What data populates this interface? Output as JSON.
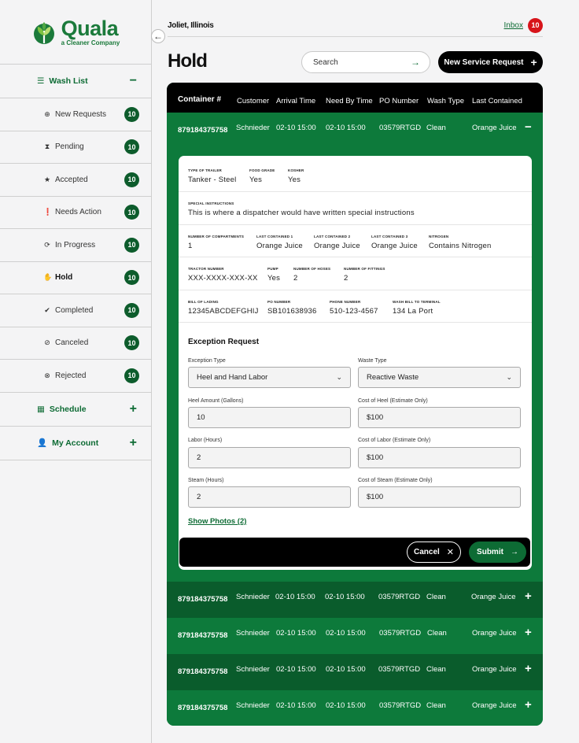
{
  "brand": {
    "name": "Quala",
    "tagline": "a Cleaner Company"
  },
  "colors": {
    "primary": "#0d7a3b",
    "dark_green": "#0d5c2c",
    "alert_red": "#d7141a",
    "black": "#000000"
  },
  "sidebar": {
    "wash_list": {
      "label": "Wash List",
      "toggle": "−",
      "icon": "list-icon"
    },
    "items": [
      {
        "label": "New Requests",
        "count": "10",
        "icon": "plus-circle-icon"
      },
      {
        "label": "Pending",
        "count": "10",
        "icon": "hourglass-icon"
      },
      {
        "label": "Accepted",
        "count": "10",
        "icon": "star-icon"
      },
      {
        "label": "Needs Action",
        "count": "10",
        "icon": "exclamation-circle-icon"
      },
      {
        "label": "In Progress",
        "count": "10",
        "icon": "refresh-icon"
      },
      {
        "label": "Hold",
        "count": "10",
        "icon": "hand-icon",
        "active": true
      },
      {
        "label": "Completed",
        "count": "10",
        "icon": "check-circle-icon"
      },
      {
        "label": "Canceled",
        "count": "10",
        "icon": "ban-icon"
      },
      {
        "label": "Rejected",
        "count": "10",
        "icon": "x-circle-icon"
      }
    ],
    "schedule": {
      "label": "Schedule",
      "toggle": "+",
      "icon": "calendar-icon"
    },
    "account": {
      "label": "My Account",
      "toggle": "+",
      "icon": "user-icon"
    }
  },
  "header": {
    "location": "Joliet, Illinois",
    "inbox_label": "Inbox",
    "inbox_count": "10"
  },
  "page": {
    "title": "Hold",
    "search_placeholder": "Search",
    "new_request_label": "New Service Request"
  },
  "table": {
    "columns": [
      "Container #",
      "Customer",
      "Arrival Time",
      "Need By Time",
      "PO Number",
      "Wash Type",
      "Last Contained"
    ],
    "rows": [
      {
        "container": "879184375758",
        "customer": "Schnieder",
        "arrival": "02-10 15:00",
        "need_by": "02-10 15:00",
        "po": "03579RTGD",
        "wash_type": "Clean",
        "last_contained": "Orange Juice",
        "toggle": "−"
      },
      {
        "container": "879184375758",
        "customer": "Schnieder",
        "arrival": "02-10 15:00",
        "need_by": "02-10 15:00",
        "po": "03579RTGD",
        "wash_type": "Clean",
        "last_contained": "Orange Juice",
        "toggle": "+"
      },
      {
        "container": "879184375758",
        "customer": "Schnieder",
        "arrival": "02-10 15:00",
        "need_by": "02-10 15:00",
        "po": "03579RTGD",
        "wash_type": "Clean",
        "last_contained": "Orange Juice",
        "toggle": "+"
      },
      {
        "container": "879184375758",
        "customer": "Schnieder",
        "arrival": "02-10 15:00",
        "need_by": "02-10 15:00",
        "po": "03579RTGD",
        "wash_type": "Clean",
        "last_contained": "Orange Juice",
        "toggle": "+"
      },
      {
        "container": "879184375758",
        "customer": "Schnieder",
        "arrival": "02-10 15:00",
        "need_by": "02-10 15:00",
        "po": "03579RTGD",
        "wash_type": "Clean",
        "last_contained": "Orange Juice",
        "toggle": "+"
      }
    ]
  },
  "detail": {
    "trailer": [
      {
        "label": "Type of Trailer",
        "value": "Tanker - Steel"
      },
      {
        "label": "Food Grade",
        "value": "Yes"
      },
      {
        "label": "Kosher",
        "value": "Yes"
      }
    ],
    "instructions": {
      "label": "Special Instructions",
      "value": "This is where a dispatcher would have written special instructions"
    },
    "compartments": [
      {
        "label": "Number of Compartments",
        "value": "1"
      },
      {
        "label": "Last Contained 1",
        "value": "Orange Juice"
      },
      {
        "label": "Last Contained 2",
        "value": "Orange Juice"
      },
      {
        "label": "Last Contained 3",
        "value": "Orange Juice"
      },
      {
        "label": "Nitrogen",
        "value": "Contains Nitrogen"
      }
    ],
    "tractor": [
      {
        "label": "Tractor Number",
        "value": "XXX-XXXX-XXX-XX"
      },
      {
        "label": "Pump",
        "value": "Yes"
      },
      {
        "label": "Number of Hoses",
        "value": "2"
      },
      {
        "label": "Number of Fittings",
        "value": "2"
      }
    ],
    "lading": [
      {
        "label": "Bill of Lading",
        "value": "12345ABCDEFGHIJ"
      },
      {
        "label": "PO Number",
        "value": "SB101638936"
      },
      {
        "label": "Phone Number",
        "value": "510-123-4567"
      },
      {
        "label": "Wash Bill to Terminal",
        "value": "134 La Port"
      }
    ]
  },
  "exception": {
    "title": "Exception Request",
    "exception_type": {
      "label": "Exception Type",
      "value": "Heel and Hand Labor"
    },
    "waste_type": {
      "label": "Waste Type",
      "value": "Reactive Waste"
    },
    "heel_amount": {
      "label": "Heel Amount (Gallons)",
      "value": "10"
    },
    "heel_cost": {
      "label": "Cost of Heel (Estimate Only)",
      "value": "$100"
    },
    "labor": {
      "label": "Labor (Hours)",
      "value": "2"
    },
    "labor_cost": {
      "label": "Cost of Labor (Estimate Only)",
      "value": "$100"
    },
    "steam": {
      "label": "Steam (Hours)",
      "value": "2"
    },
    "steam_cost": {
      "label": "Cost of Steam (Estimate Only)",
      "value": "$100"
    },
    "show_photos": "Show Photos (2)",
    "cancel_label": "Cancel",
    "submit_label": "Submit"
  }
}
